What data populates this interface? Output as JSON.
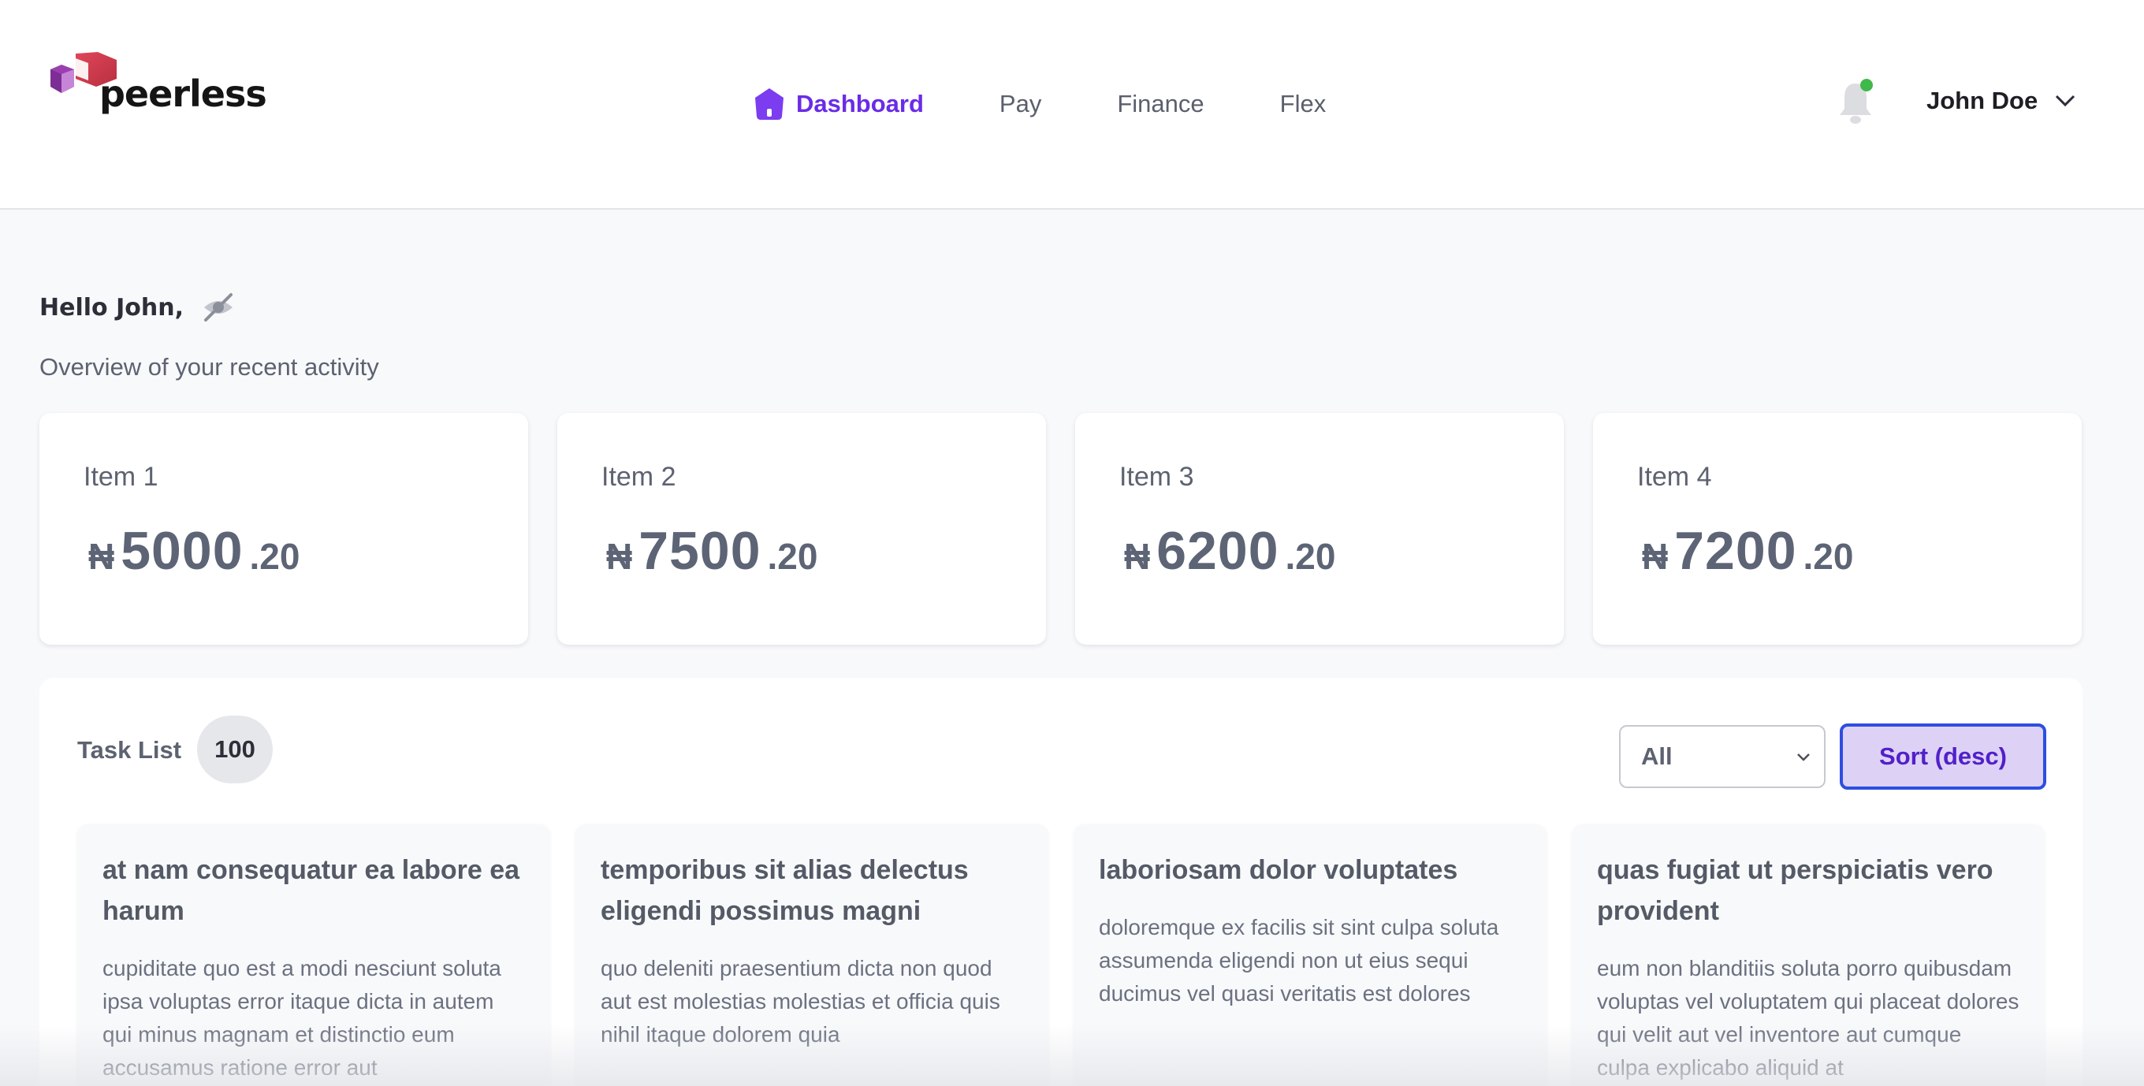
{
  "brand": {
    "name": "peerless"
  },
  "nav": {
    "items": [
      {
        "label": "Dashboard",
        "active": true,
        "icon": "home-icon"
      },
      {
        "label": "Pay",
        "active": false
      },
      {
        "label": "Finance",
        "active": false
      },
      {
        "label": "Flex",
        "active": false
      }
    ]
  },
  "header": {
    "notification_icon": "bell-icon",
    "notification_dot_color": "#3fb94a",
    "user_name": "John Doe"
  },
  "greeting": {
    "hello": "Hello John,",
    "toggle_icon": "eye-off-icon",
    "subtitle": "Overview of your recent activity"
  },
  "cards": [
    {
      "label": "Item 1",
      "currency": "₦",
      "whole": "5000",
      "decimal": ".20"
    },
    {
      "label": "Item 2",
      "currency": "₦",
      "whole": "7500",
      "decimal": ".20"
    },
    {
      "label": "Item 3",
      "currency": "₦",
      "whole": "6200",
      "decimal": ".20"
    },
    {
      "label": "Item 4",
      "currency": "₦",
      "whole": "7200",
      "decimal": ".20"
    }
  ],
  "tasks": {
    "title": "Task List",
    "count": "100",
    "filter": {
      "selected": "All"
    },
    "sort_label": "Sort (desc)",
    "items": [
      {
        "title": "at nam consequatur ea labore ea harum",
        "body": "cupiditate quo est a modi nesciunt soluta ipsa voluptas error itaque dicta in autem qui minus magnam et distinctio eum accusamus ratione error aut"
      },
      {
        "title": "temporibus sit alias delectus eligendi possimus magni",
        "body": "quo deleniti praesentium dicta non quod aut est molestias molestias et officia quis nihil itaque dolorem quia"
      },
      {
        "title": "laboriosam dolor voluptates",
        "body": "doloremque ex facilis sit sint culpa soluta assumenda eligendi non ut eius sequi ducimus vel quasi veritatis est dolores"
      },
      {
        "title": "quas fugiat ut perspiciatis vero provident",
        "body": "eum non blanditiis soluta porro quibusdam voluptas vel voluptatem qui placeat dolores qui velit aut vel inventore aut cumque culpa explicabo aliquid at"
      }
    ]
  },
  "colors": {
    "accent": "#6a2be8",
    "sort_border": "#2d4ee0",
    "sort_bg": "#ddd2f6"
  }
}
